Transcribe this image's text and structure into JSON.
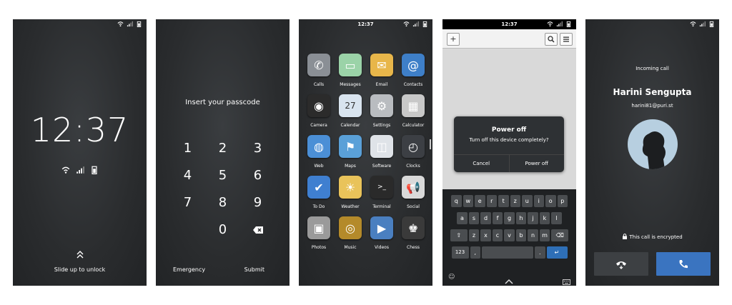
{
  "lock": {
    "time": "12:37",
    "slide_label": "Slide up to unlock"
  },
  "passcode": {
    "title": "Insert your passcode",
    "keys": [
      "1",
      "2",
      "3",
      "4",
      "5",
      "6",
      "7",
      "8",
      "9",
      "",
      "0",
      "⌫"
    ],
    "emergency": "Emergency",
    "submit": "Submit"
  },
  "home": {
    "time": "12:37",
    "apps": [
      {
        "label": "Calls",
        "icon": "phone-icon",
        "color": "#8a8f95",
        "glyph": "✆"
      },
      {
        "label": "Messages",
        "icon": "messages-icon",
        "color": "#9bd3a8",
        "glyph": "▭"
      },
      {
        "label": "Email",
        "icon": "email-icon",
        "color": "#e8b64a",
        "glyph": "✉"
      },
      {
        "label": "Contacts",
        "icon": "contacts-icon",
        "color": "#3e7fc8",
        "glyph": "@"
      },
      {
        "label": "Camera",
        "icon": "camera-icon",
        "color": "#2b2b2b",
        "glyph": "◉"
      },
      {
        "label": "Calendar",
        "icon": "calendar-icon",
        "color": "#d9e4ef",
        "glyph": "27"
      },
      {
        "label": "Settings",
        "icon": "settings-icon",
        "color": "#b9bcc0",
        "glyph": "⚙"
      },
      {
        "label": "Calculator",
        "icon": "calculator-icon",
        "color": "#c8c8c8",
        "glyph": "▦"
      },
      {
        "label": "Web",
        "icon": "web-icon",
        "color": "#4b8fd6",
        "glyph": "◍"
      },
      {
        "label": "Maps",
        "icon": "maps-icon",
        "color": "#5aa0d8",
        "glyph": "⚑"
      },
      {
        "label": "Software",
        "icon": "software-icon",
        "color": "#dfe3e8",
        "glyph": "◫"
      },
      {
        "label": "Clocks",
        "icon": "clock-icon",
        "color": "#3c3f44",
        "glyph": "◴"
      },
      {
        "label": "To Do",
        "icon": "todo-icon",
        "color": "#3f7fd0",
        "glyph": "✔"
      },
      {
        "label": "Weather",
        "icon": "weather-icon",
        "color": "#e9c35a",
        "glyph": "☀"
      },
      {
        "label": "Terminal",
        "icon": "terminal-icon",
        "color": "#2a2a2a",
        "glyph": ">_"
      },
      {
        "label": "Social",
        "icon": "social-icon",
        "color": "#d9d9d9",
        "glyph": "📢"
      },
      {
        "label": "Photos",
        "icon": "photos-icon",
        "color": "#9a9a9a",
        "glyph": "▣"
      },
      {
        "label": "Music",
        "icon": "music-icon",
        "color": "#b48a2a",
        "glyph": "◎"
      },
      {
        "label": "Videos",
        "icon": "videos-icon",
        "color": "#4a7fc0",
        "glyph": "▶"
      },
      {
        "label": "Chess",
        "icon": "chess-icon",
        "color": "#3a3a3a",
        "glyph": "♚"
      }
    ]
  },
  "browser": {
    "time": "12:37",
    "new_tab": "+",
    "dialog_title": "Power off",
    "dialog_text": "Turn off this device completely?",
    "cancel": "Cancel",
    "power_off": "Power off",
    "row1": [
      "q",
      "w",
      "e",
      "r",
      "t",
      "z",
      "u",
      "i",
      "o",
      "p"
    ],
    "row2": [
      "a",
      "s",
      "d",
      "f",
      "g",
      "h",
      "j",
      "k",
      "l"
    ],
    "row3": [
      "z",
      "x",
      "c",
      "v",
      "b",
      "n",
      "m"
    ],
    "num_key": "123",
    "comma": ",",
    "period": "."
  },
  "call": {
    "status": "Incoming call",
    "name": "Harini Sengupta",
    "email": "harini81@puri.st",
    "encrypted": "This call is encrypted",
    "decline_color": "#3d4043",
    "accept_color": "#3a74c0"
  }
}
